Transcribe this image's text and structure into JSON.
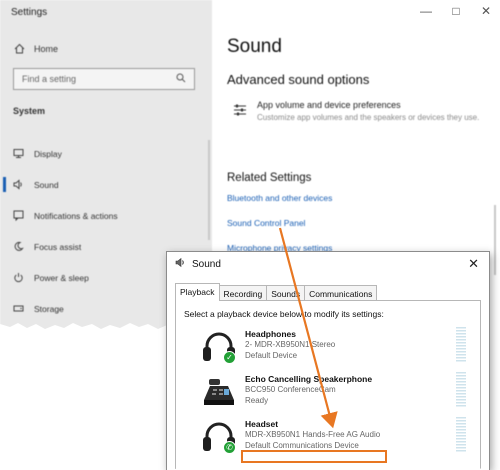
{
  "settings": {
    "window_title": "Settings",
    "home_label": "Home",
    "search_placeholder": "Find a setting",
    "section_label": "System",
    "nav_items": [
      {
        "label": "Display",
        "icon": "monitor-icon"
      },
      {
        "label": "Sound",
        "icon": "speaker-icon",
        "active": true
      },
      {
        "label": "Notifications & actions",
        "icon": "notification-icon"
      },
      {
        "label": "Focus assist",
        "icon": "moon-icon"
      },
      {
        "label": "Power & sleep",
        "icon": "power-icon"
      },
      {
        "label": "Storage",
        "icon": "storage-icon"
      }
    ],
    "page_title": "Sound",
    "advanced_title": "Advanced sound options",
    "app_volume_title": "App volume and device preferences",
    "app_volume_desc": "Customize app volumes and the speakers or devices they use.",
    "related_title": "Related Settings",
    "links": [
      "Bluetooth and other devices",
      "Sound Control Panel",
      "Microphone privacy settings"
    ]
  },
  "dialog": {
    "title": "Sound",
    "tabs": [
      "Playback",
      "Recording",
      "Sounds",
      "Communications"
    ],
    "active_tab": "Playback",
    "instruction": "Select a playback device below to modify its settings:",
    "devices": [
      {
        "name": "Headphones",
        "desc": "2- MDR-XB950N1 Stereo",
        "status": "Default Device"
      },
      {
        "name": "Echo Cancelling Speakerphone",
        "desc": "BCC950 ConferenceCam",
        "status": "Ready"
      },
      {
        "name": "Headset",
        "desc": "MDR-XB950N1 Hands-Free AG Audio",
        "status": "Default Communications Device"
      }
    ]
  },
  "colors": {
    "accent_link": "#1a5fb4",
    "highlight": "#e87722",
    "badge_green": "#22a036"
  }
}
